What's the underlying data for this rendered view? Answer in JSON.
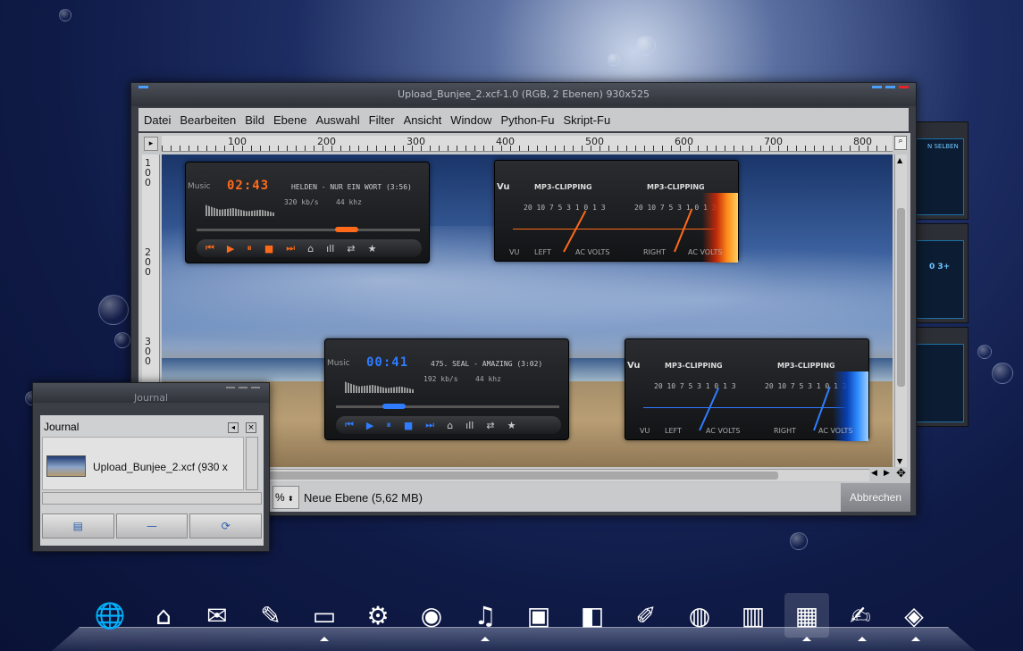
{
  "gimp": {
    "title": "Upload_Bunjee_2.xcf-1.0 (RGB, 2 Ebenen) 930x525",
    "menu": [
      "Datei",
      "Bearbeiten",
      "Bild",
      "Ebene",
      "Auswahl",
      "Filter",
      "Ansicht",
      "Window",
      "Python-Fu",
      "Skript-Fu"
    ],
    "ruler_top": [
      "100",
      "200",
      "300",
      "400",
      "500",
      "600",
      "700",
      "800"
    ],
    "ruler_left": [
      "1\n0\n0",
      "2\n0\n0",
      "3\n0\n0"
    ],
    "zoom": "%",
    "status": "Neue Ebene (5,62 MB)",
    "cancel": "Abbrechen"
  },
  "player1": {
    "label": "Music",
    "time": "02:43",
    "song": "HELDEN - NUR EIN WORT (3:56)",
    "kbps": "320 kb/s",
    "khz": "44 khz",
    "accent": "#ff6a1a"
  },
  "player2": {
    "label": "Music",
    "time": "00:41",
    "song": "475. SEAL - AMAZING (3:02)",
    "kbps": "192 kb/s",
    "khz": "44 khz",
    "accent": "#2f7cff"
  },
  "vu1": {
    "label": "Vu",
    "clip": "MP3-CLIPPING",
    "scale": "20 10 7 5 3 1 0 1 3",
    "left": "LEFT",
    "right": "RIGHT",
    "vu": "VU",
    "ac": "AC VOLTS",
    "accent": "#ff6a1a"
  },
  "vu2": {
    "label": "Vu",
    "clip": "MP3-CLIPPING",
    "scale": "20 10 7 5 3 1 0 1 3",
    "left": "LEFT",
    "right": "RIGHT",
    "vu": "VU",
    "ac": "AC VOLTS",
    "accent": "#2f7cff"
  },
  "journal": {
    "title": "Journal",
    "header": "Journal",
    "item": "Upload_Bunjee_2.xcf (930 x"
  },
  "side": {
    "text1": "N SELBEN",
    "text2": "0 3+"
  }
}
